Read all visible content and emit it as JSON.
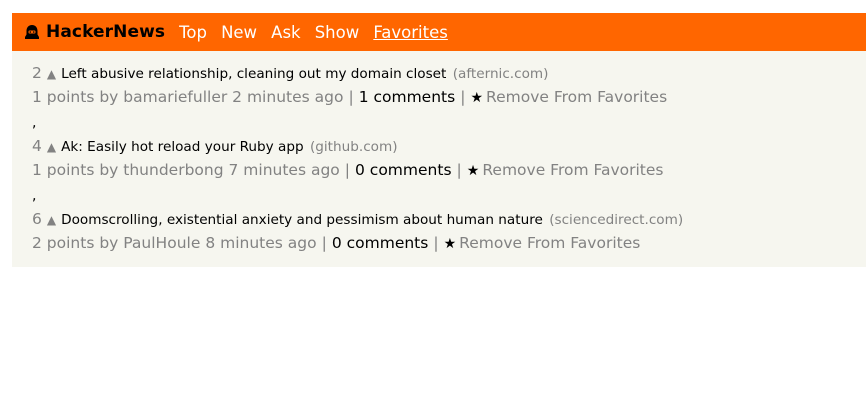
{
  "header": {
    "brand": "HackerNews",
    "nav": [
      {
        "label": "Top",
        "active": false
      },
      {
        "label": "New",
        "active": false
      },
      {
        "label": "Ask",
        "active": false
      },
      {
        "label": "Show",
        "active": false
      },
      {
        "label": "Favorites",
        "active": true
      }
    ]
  },
  "colors": {
    "header_bg": "#ff6600",
    "content_bg": "#f6f6ef",
    "muted": "#828282"
  },
  "separator": ",",
  "items": [
    {
      "rank": "2",
      "vote_icon": "▲",
      "title": "Left abusive relationship, cleaning out my domain closet",
      "site": "(afternic.com)",
      "points": "1 points by",
      "user": "bamariefuller",
      "age": "2 minutes ago",
      "comments": "1 comments",
      "action_icon": "★",
      "action": "Remove From Favorites"
    },
    {
      "rank": "4",
      "vote_icon": "▲",
      "title": "Ak: Easily hot reload your Ruby app",
      "site": "(github.com)",
      "points": "1 points by",
      "user": "thunderbong",
      "age": "7 minutes ago",
      "comments": "0 comments",
      "action_icon": "★",
      "action": "Remove From Favorites"
    },
    {
      "rank": "6",
      "vote_icon": "▲",
      "title": "Doomscrolling, existential anxiety and pessimism about human nature",
      "site": "(sciencedirect.com)",
      "points": "2 points by",
      "user": "PaulHoule",
      "age": "8 minutes ago",
      "comments": "0 comments",
      "action_icon": "★",
      "action": "Remove From Favorites"
    }
  ]
}
